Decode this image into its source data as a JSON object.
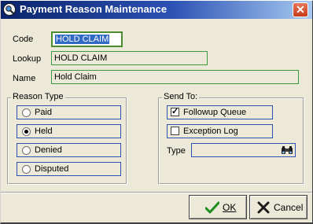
{
  "window": {
    "title": "Payment Reason Maintenance"
  },
  "form": {
    "code_label": "Code",
    "code_value": "HOLD CLAIM",
    "lookup_label": "Lookup",
    "lookup_value": "HOLD CLAIM",
    "name_label": "Name",
    "name_value": "Hold Claim"
  },
  "reason_type": {
    "title": "Reason Type",
    "options": [
      {
        "label": "Paid",
        "checked": false
      },
      {
        "label": "Held",
        "checked": true
      },
      {
        "label": "Denied",
        "checked": false
      },
      {
        "label": "Disputed",
        "checked": false
      }
    ]
  },
  "send_to": {
    "title": "Send To:",
    "followup_label": "Followup Queue",
    "followup_checked": true,
    "exception_label": "Exception Log",
    "exception_checked": false,
    "type_label": "Type",
    "type_value": ""
  },
  "buttons": {
    "ok_label": "OK",
    "cancel_label": "Cancel"
  },
  "icons": {
    "app": "magnifier-app-icon",
    "close": "close-icon",
    "lookup": "binoculars-icon",
    "ok": "checkmark-icon",
    "cancel": "x-icon"
  },
  "colors": {
    "titlebar_start": "#0a246a",
    "titlebar_end": "#a6caf0",
    "close_button": "#c63c1c",
    "field_border": "#3c9a3c",
    "option_border": "#2c52b4"
  }
}
